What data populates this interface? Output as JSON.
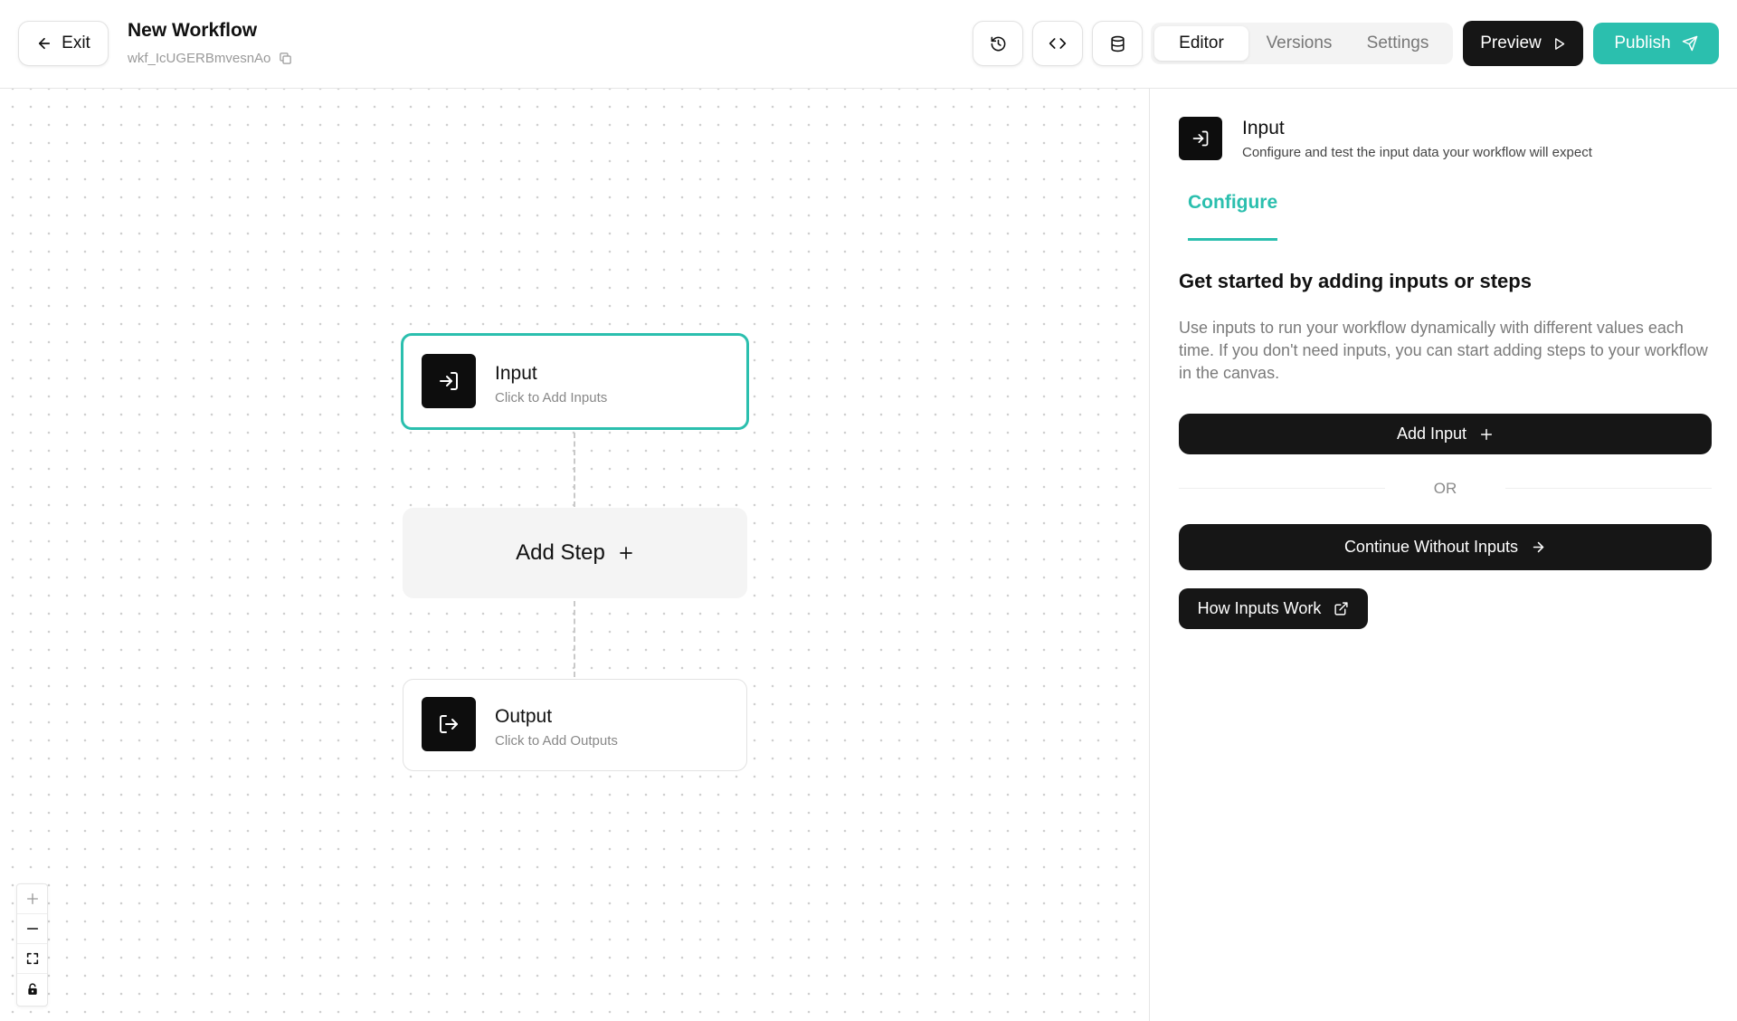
{
  "header": {
    "exit_label": "Exit",
    "workflow_title": "New Workflow",
    "workflow_id": "wkf_IcUGERBmvesnAo",
    "tabs": [
      {
        "label": "Editor",
        "active": true
      },
      {
        "label": "Versions",
        "active": false
      },
      {
        "label": "Settings",
        "active": false
      }
    ],
    "preview_label": "Preview",
    "publish_label": "Publish",
    "icons": {
      "history": "history-icon",
      "code": "code-icon",
      "database": "database-icon"
    }
  },
  "canvas": {
    "input_node": {
      "title": "Input",
      "subtitle": "Click to Add Inputs",
      "icon": "sign-in-icon"
    },
    "add_step_label": "Add Step",
    "output_node": {
      "title": "Output",
      "subtitle": "Click to Add Outputs",
      "icon": "sign-out-icon"
    },
    "controls": [
      "zoom-in-icon",
      "zoom-out-icon",
      "fit-view-icon",
      "lock-icon"
    ]
  },
  "panel": {
    "title": "Input",
    "subtitle": "Configure and test the input data your workflow will expect",
    "tab_label": "Configure",
    "heading": "Get started by adding inputs or steps",
    "description": "Use inputs to run your workflow dynamically with different values each time. If you don't need inputs, you can start adding steps to your workflow in the canvas.",
    "add_input_label": "Add Input",
    "or_label": "OR",
    "continue_label": "Continue Without Inputs",
    "how_label": "How Inputs Work"
  },
  "colors": {
    "accent": "#2bbfae",
    "dark": "#161616"
  }
}
